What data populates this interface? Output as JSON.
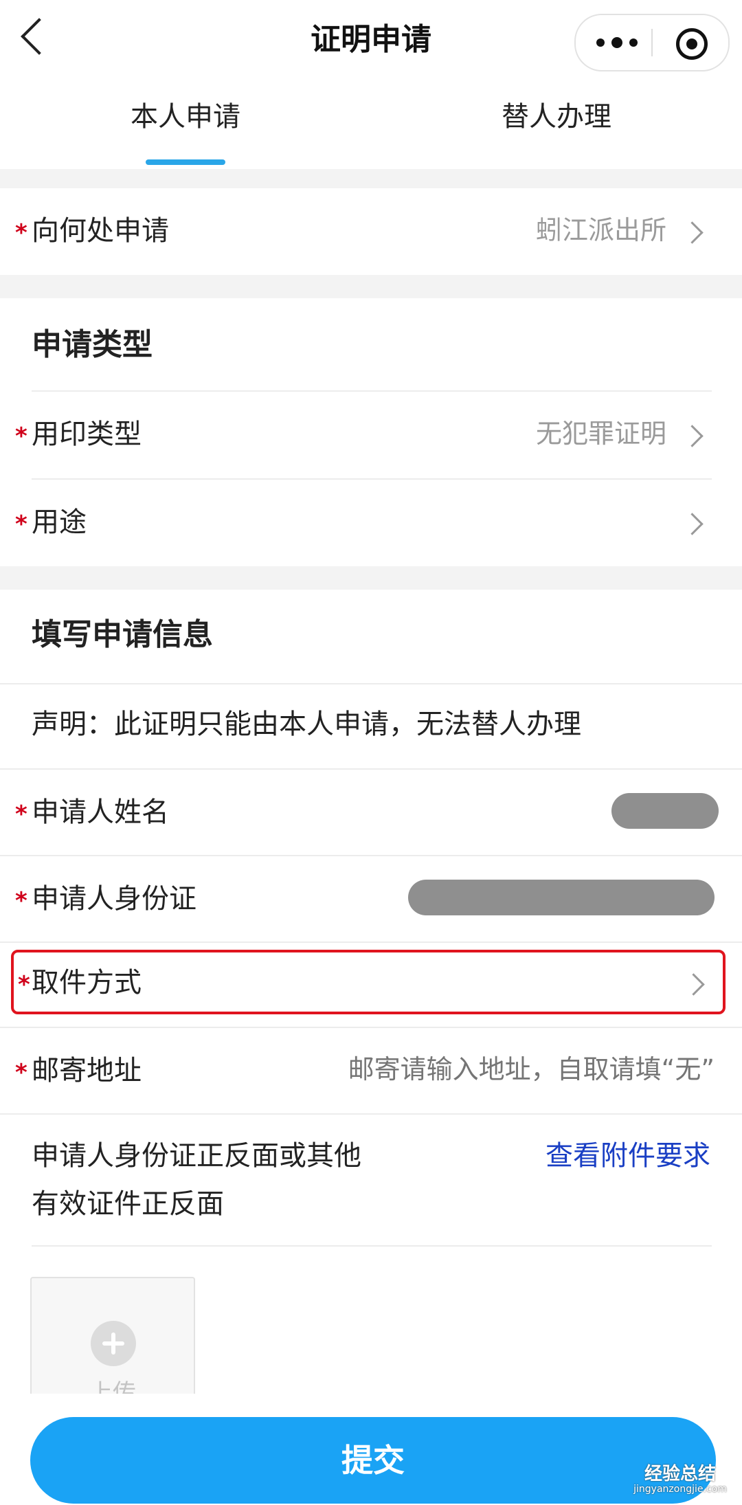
{
  "header": {
    "title": "证明申请",
    "more_icon": "more-dots-icon",
    "close_icon": "capsule-close-icon",
    "back_icon": "back-chevron-icon"
  },
  "tabs": [
    {
      "label": "本人申请",
      "active": true
    },
    {
      "label": "替人办理",
      "active": false
    }
  ],
  "location": {
    "label": "向何处申请",
    "value": "蚓江派出所",
    "required": true
  },
  "apply_type": {
    "section_title": "申请类型",
    "seal_type": {
      "label": "用印类型",
      "value": "无犯罪证明",
      "required": true
    },
    "purpose": {
      "label": "用途",
      "value": "",
      "required": true
    }
  },
  "info": {
    "section_title": "填写申请信息",
    "notice": "声明：此证明只能由本人申请，无法替人办理",
    "name_label": "申请人姓名",
    "id_label": "申请人身份证",
    "pickup_label": "取件方式",
    "address_label": "邮寄地址",
    "address_placeholder": "邮寄请输入地址，自取请填“无”",
    "attach_line1": "申请人身份证正反面或其他",
    "attach_line2": "有效证件正反面",
    "attach_link": "查看附件要求",
    "upload_label": "上传"
  },
  "submit_label": "提交",
  "watermark": {
    "line1": "经验总结",
    "line2": "jingyanzongjie.com"
  },
  "colors": {
    "accent": "#1aa3f5",
    "tab_indicator": "#2aa6e8",
    "required_star": "#d0021b",
    "link": "#1a3fc4",
    "highlight_border": "#e0141e"
  }
}
